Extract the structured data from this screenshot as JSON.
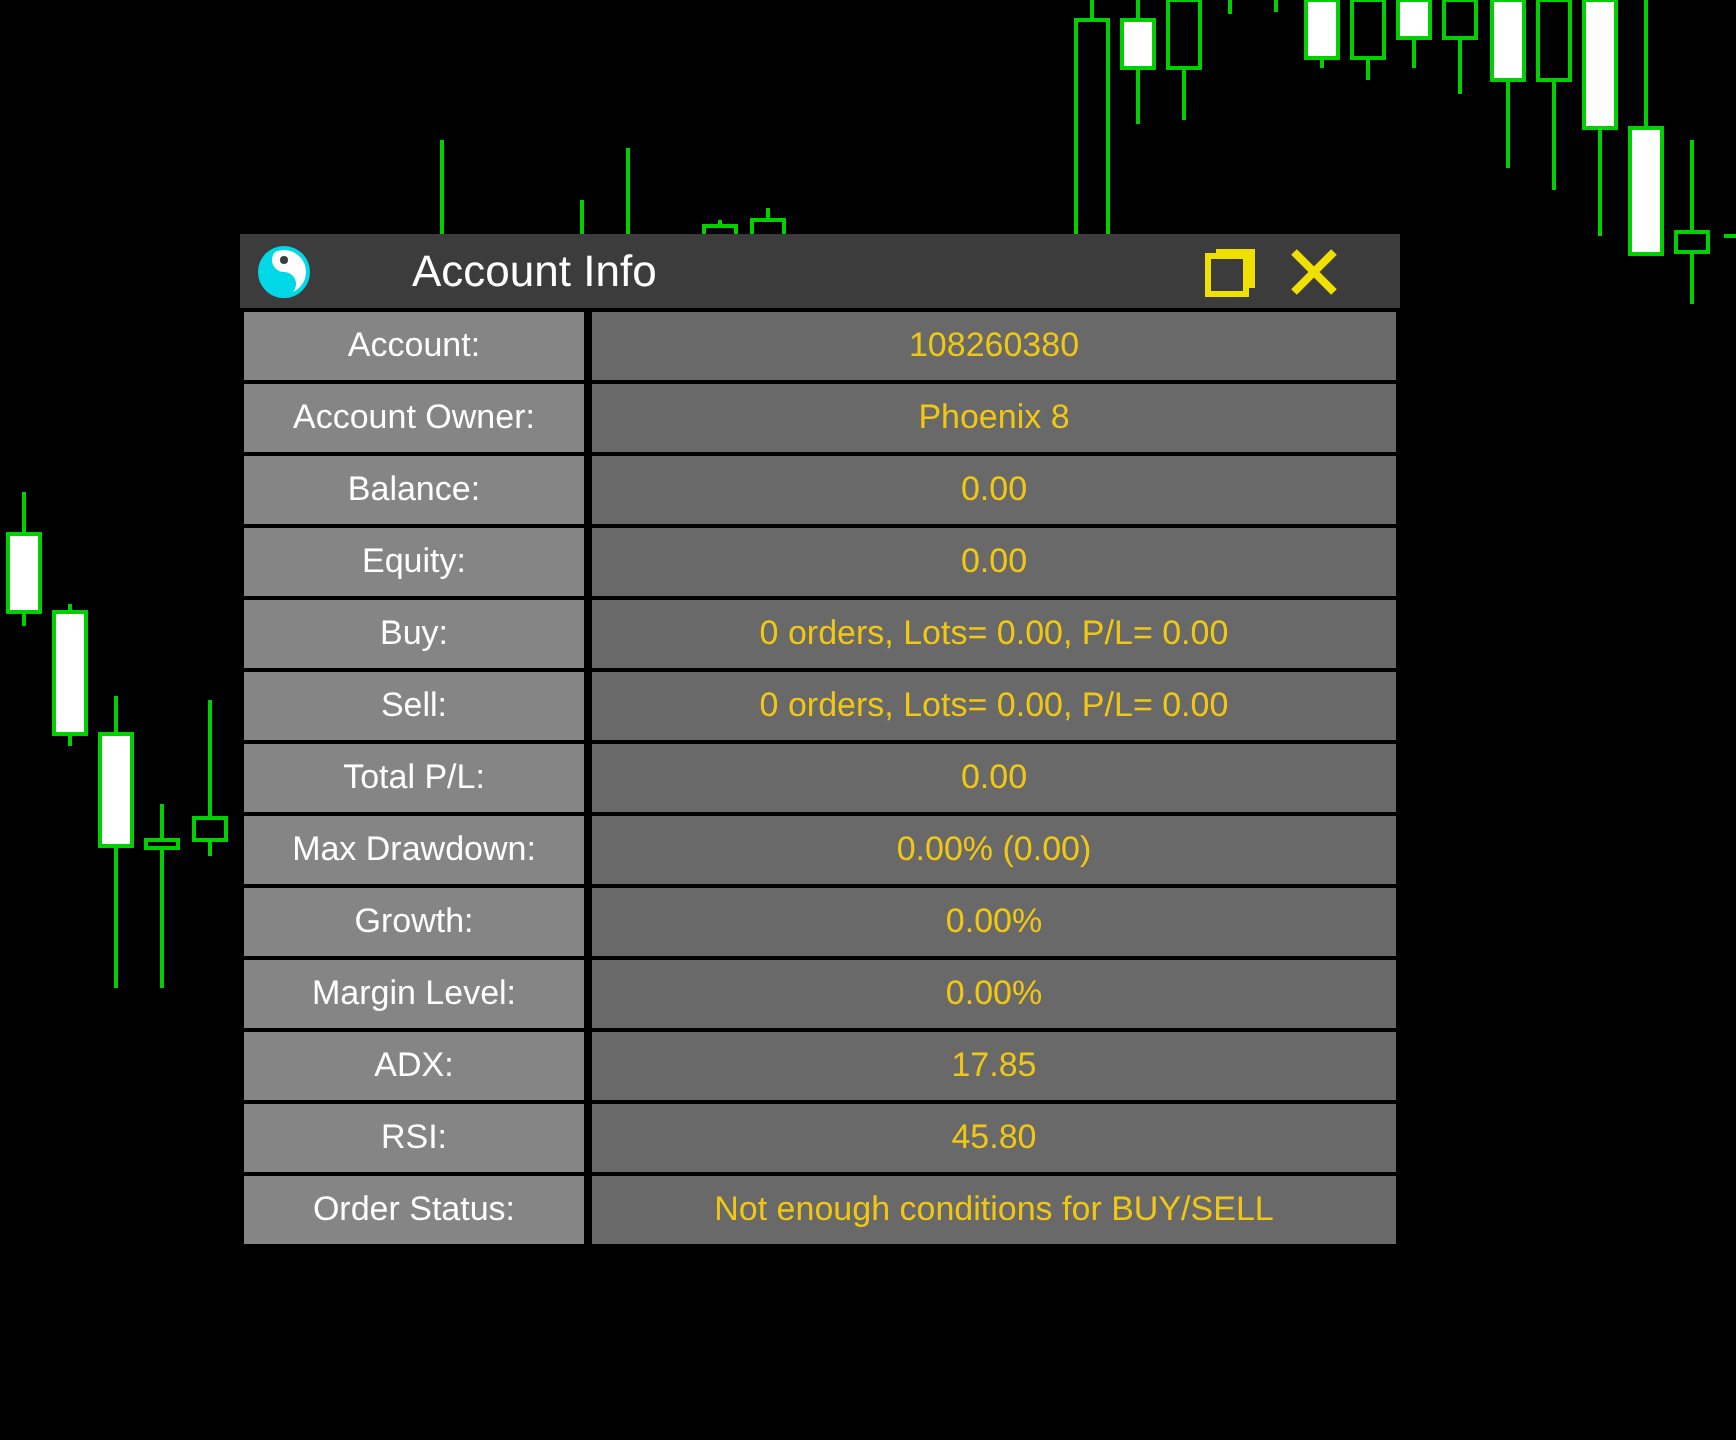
{
  "window": {
    "title": "Account Info"
  },
  "rows": [
    {
      "label": "Account:",
      "value": "108260380"
    },
    {
      "label": "Account Owner:",
      "value": "Phoenix 8"
    },
    {
      "label": "Balance:",
      "value": "0.00"
    },
    {
      "label": "Equity:",
      "value": "0.00"
    },
    {
      "label": "Buy:",
      "value": "0 orders, Lots= 0.00, P/L= 0.00"
    },
    {
      "label": "Sell:",
      "value": "0 orders, Lots= 0.00, P/L= 0.00"
    },
    {
      "label": "Total P/L:",
      "value": "0.00"
    },
    {
      "label": "Max Drawdown:",
      "value": "0.00% (0.00)"
    },
    {
      "label": "Growth:",
      "value": "0.00%"
    },
    {
      "label": "Margin Level:",
      "value": "0.00%"
    },
    {
      "label": "ADX:",
      "value": "17.85"
    },
    {
      "label": "RSI:",
      "value": "45.80"
    },
    {
      "label": "Order Status:",
      "value": "Not enough conditions for BUY/SELL"
    }
  ]
}
